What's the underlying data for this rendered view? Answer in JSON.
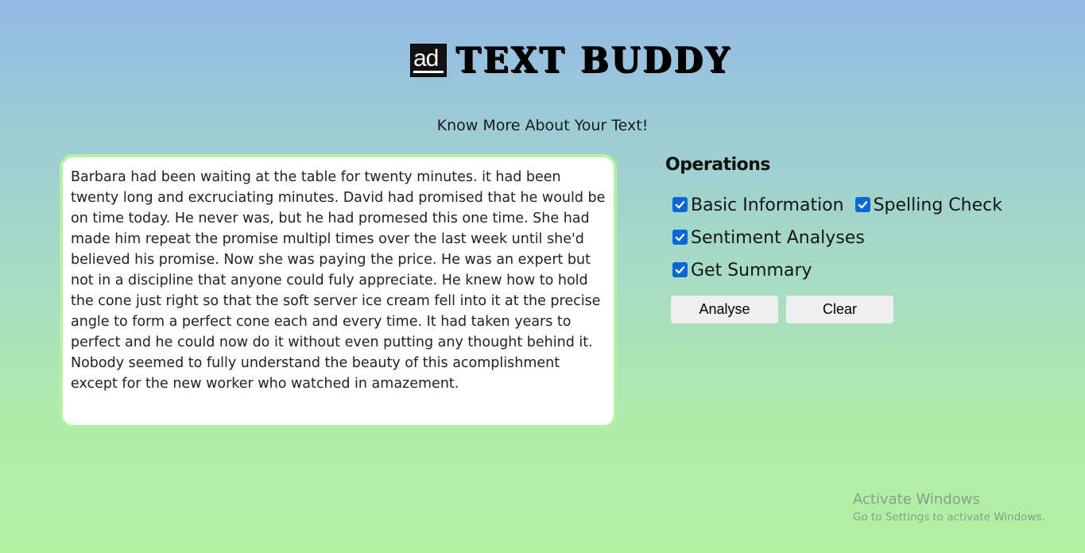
{
  "header": {
    "logo_badge": "ad",
    "logo_text": "TEXT BUDDY",
    "subtitle": "Know More About Your Text!"
  },
  "editor": {
    "text": "Barbara had been waiting at the table for twenty minutes. it had been twenty long and excruciating minutes. David had promised that he would be on time today. He never was, but he had promesed this one time. She had made him repeat the promise multipl times over the last week until she'd believed his promise. Now she was paying the price. He was an expert but not in a discipline that anyone could fuly appreciate. He knew how to hold the cone just right so that the soft server ice cream fell into it at the precise angle to form a perfect cone each and every time. It had taken years to perfect and he could now do it without even putting any thought behind it. Nobody seemed to fully understand the beauty of this acomplishment except for the new worker who watched in amazement."
  },
  "operations": {
    "title": "Operations",
    "options": [
      {
        "label": "Basic Information",
        "checked": true
      },
      {
        "label": "Spelling Check",
        "checked": true
      },
      {
        "label": "Sentiment Analyses",
        "checked": true
      },
      {
        "label": "Get Summary",
        "checked": true
      }
    ],
    "analyse_label": "Analyse",
    "clear_label": "Clear"
  },
  "watermark": {
    "title": "Activate Windows",
    "subtitle": "Go to Settings to activate Windows."
  },
  "colors": {
    "gradient_top": "#93b9e6",
    "gradient_bottom": "#b3f1a3",
    "textbox_border": "#b3f1a3",
    "checkbox_accent": "#0b66d6",
    "button_bg": "#efefef"
  }
}
